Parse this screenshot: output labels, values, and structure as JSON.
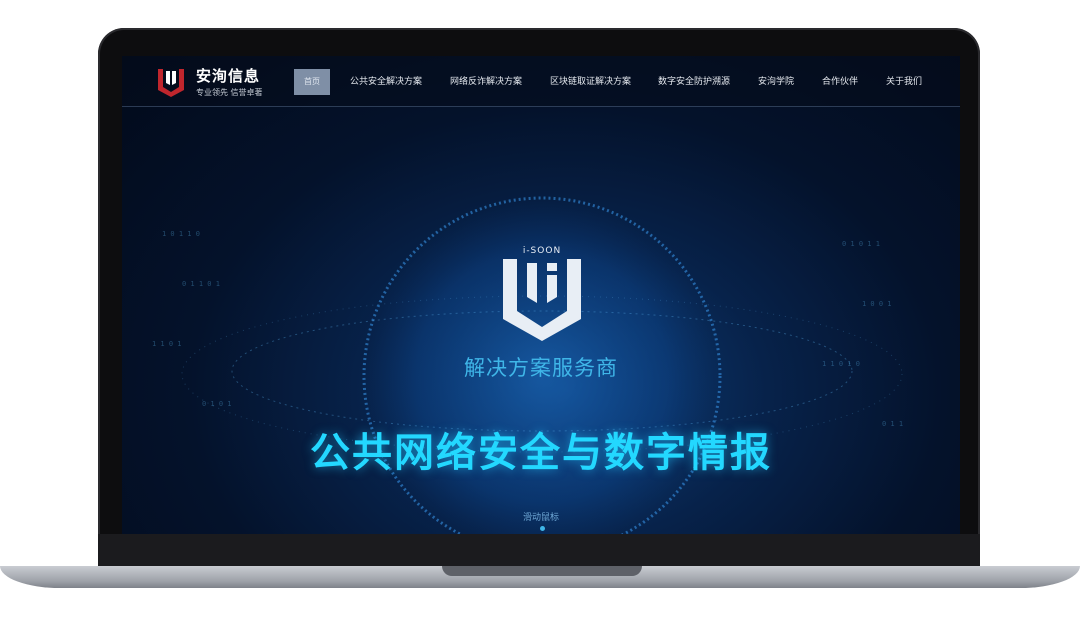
{
  "brand": {
    "name": "安洵信息",
    "slogan": "专业领先 信誉卓著"
  },
  "nav": {
    "home_label": "首页",
    "items": [
      "公共安全解决方案",
      "网络反诈解决方案",
      "区块链取证解决方案",
      "数字安全防护溯源",
      "安洵学院",
      "合作伙伴",
      "关于我们"
    ]
  },
  "hero": {
    "logo_text": "i-SOON",
    "subtitle": "解决方案服务商",
    "title": "公共网络安全与数字情报",
    "scroll_hint": "滑动鼠标"
  },
  "colors": {
    "accent": "#23d8ff",
    "brand_red": "#c0262d",
    "background": "#04122b"
  }
}
